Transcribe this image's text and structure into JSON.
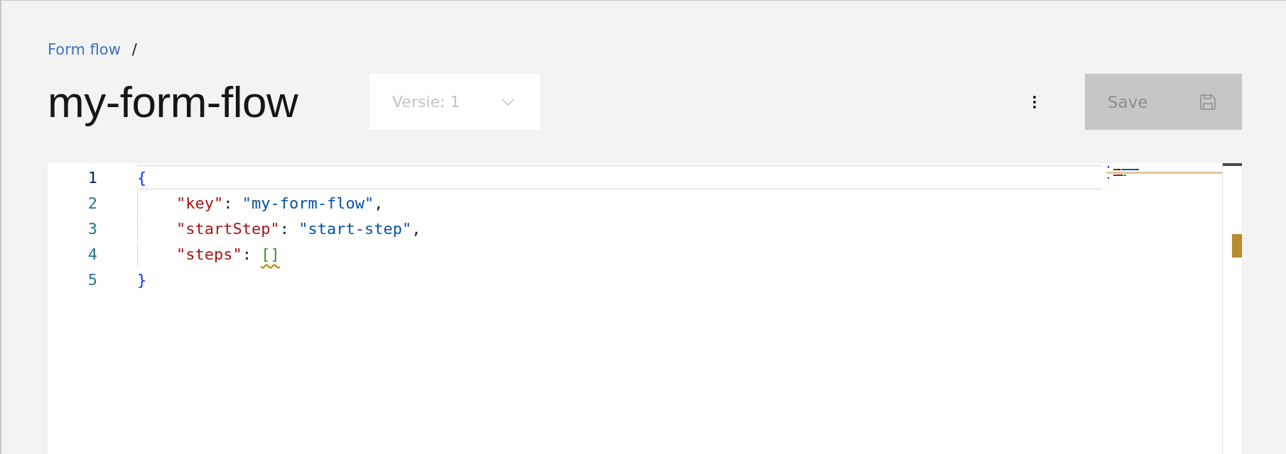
{
  "breadcrumb": {
    "link": "Form flow",
    "separator": "/"
  },
  "title": "my-form-flow",
  "version_select": {
    "value": "Versie: 1",
    "disabled": true
  },
  "save_button": {
    "label": "Save",
    "disabled": true
  },
  "editor": {
    "lines": [
      {
        "number": "1",
        "current": true,
        "indented": false,
        "tokens": [
          {
            "kind": "bracket",
            "text": "{"
          }
        ]
      },
      {
        "number": "2",
        "current": false,
        "indented": true,
        "tokens": [
          {
            "kind": "key",
            "text": "\"key\""
          },
          {
            "kind": "punct",
            "text": ": "
          },
          {
            "kind": "string",
            "text": "\"my-form-flow\""
          },
          {
            "kind": "punct",
            "text": ","
          }
        ]
      },
      {
        "number": "3",
        "current": false,
        "indented": true,
        "tokens": [
          {
            "kind": "key",
            "text": "\"startStep\""
          },
          {
            "kind": "punct",
            "text": ": "
          },
          {
            "kind": "string",
            "text": "\"start-step\""
          },
          {
            "kind": "punct",
            "text": ","
          }
        ]
      },
      {
        "number": "4",
        "current": false,
        "indented": true,
        "tokens": [
          {
            "kind": "key",
            "text": "\"steps\""
          },
          {
            "kind": "punct",
            "text": ": "
          },
          {
            "kind": "array",
            "text": "[]",
            "warning": true
          }
        ]
      },
      {
        "number": "5",
        "current": false,
        "indented": false,
        "tokens": [
          {
            "kind": "bracket",
            "text": "}"
          }
        ]
      }
    ]
  }
}
